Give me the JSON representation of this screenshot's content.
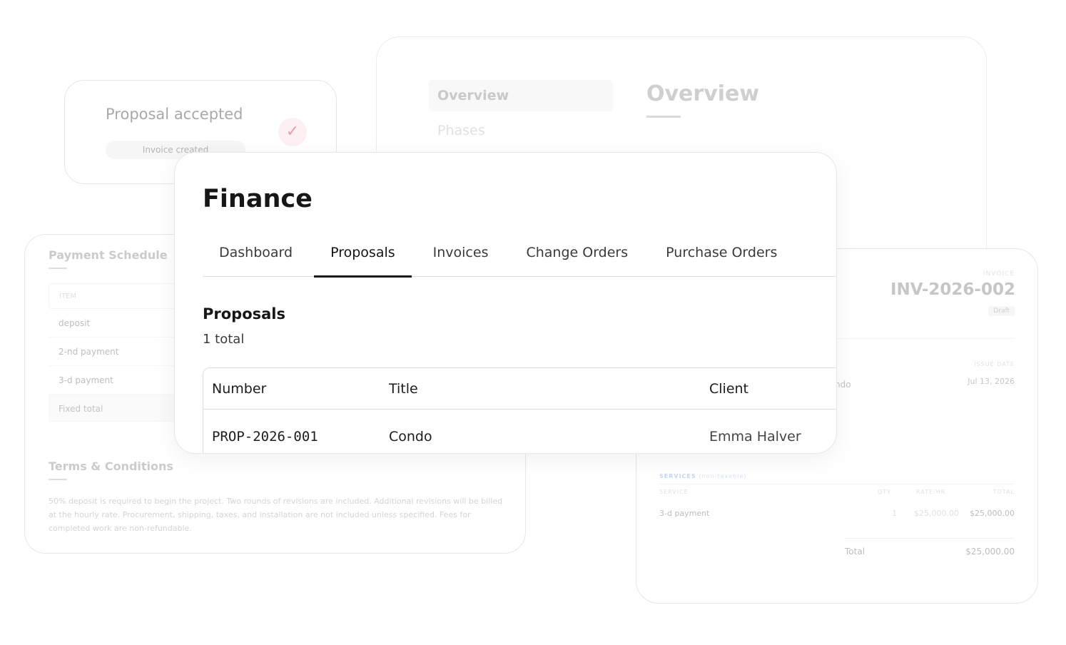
{
  "overview": {
    "nav_items": [
      "Overview",
      "Phases"
    ],
    "title": "Overview"
  },
  "accepted": {
    "title": "Proposal accepted",
    "check_icon": "✓",
    "pill": "Invoice created",
    "check_color": "#ef9aa9"
  },
  "schedule": {
    "title": "Payment Schedule",
    "column": "ITEM",
    "rows": [
      "deposit",
      "2-nd payment",
      "3-d payment"
    ],
    "total_label": "Fixed total",
    "terms_title": "Terms & Conditions",
    "terms_text": "50% deposit is required to begin the project. Two rounds of revisions are included. Additional revisions will be billed at the hourly rate. Procurement, shipping, taxes, and installation are not included unless specified. Fees for completed work are non-refundable."
  },
  "invoice": {
    "kicker": "INVOICE",
    "number": "INV-2026-002",
    "status": "Draft",
    "issue_label": "ISSUE DATE",
    "issue_date": "Jul 13, 2026",
    "project_partial": "ndo",
    "services_title": "SERVICES",
    "services_note": "(non-taxable)",
    "headers": {
      "service": "SERVICE",
      "qty": "QTY",
      "rate": "RATE/HR",
      "total": "TOTAL"
    },
    "line": {
      "service": "3-d payment",
      "qty": "1",
      "rate": "$25,000.00",
      "total": "$25,000.00"
    },
    "total_label": "Total",
    "total_value": "$25,000.00"
  },
  "finance": {
    "title": "Finance",
    "tabs": [
      "Dashboard",
      "Proposals",
      "Invoices",
      "Change Orders",
      "Purchase Orders"
    ],
    "active_tab": "Proposals",
    "section_title": "Proposals",
    "count_label": "1 total",
    "table": {
      "headers": [
        "Number",
        "Title",
        "Client"
      ],
      "rows": [
        {
          "number": "PROP-2026-001",
          "title": "Condo",
          "client": "Emma Halver"
        }
      ]
    }
  }
}
